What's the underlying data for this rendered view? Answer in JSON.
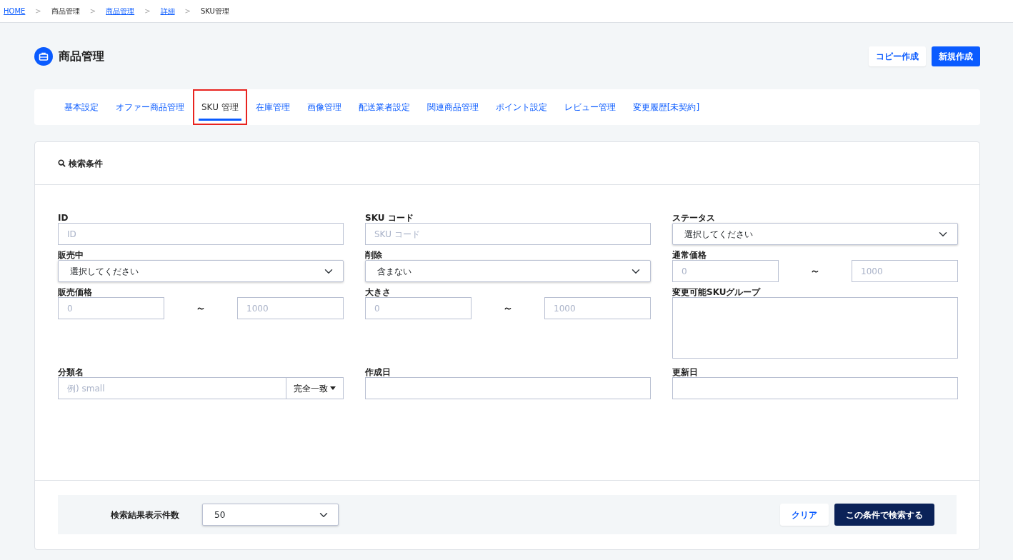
{
  "breadcrumb": [
    {
      "label": "HOME",
      "link": true
    },
    {
      "label": "商品管理",
      "link": false
    },
    {
      "label": "商品管理",
      "link": true
    },
    {
      "label": "詳細",
      "link": true
    },
    {
      "label": "SKU管理",
      "link": false
    }
  ],
  "breadcrumb_separator": ">",
  "page_title": "商品管理",
  "header_buttons": [
    {
      "label": "コピー作成",
      "kind": "secondary"
    },
    {
      "label": "新規作成",
      "kind": "primary"
    }
  ],
  "tabs": [
    {
      "label": "基本設定",
      "selected": false,
      "highlighted": false
    },
    {
      "label": "オファー商品管理",
      "selected": false,
      "highlighted": false
    },
    {
      "label": "SKU 管理",
      "selected": true,
      "highlighted": true
    },
    {
      "label": "在庫管理",
      "selected": false,
      "highlighted": false
    },
    {
      "label": "画像管理",
      "selected": false,
      "highlighted": false
    },
    {
      "label": "配送業者設定",
      "selected": false,
      "highlighted": false
    },
    {
      "label": "関連商品管理",
      "selected": false,
      "highlighted": false
    },
    {
      "label": "ポイント設定",
      "selected": false,
      "highlighted": false
    },
    {
      "label": "レビュー管理",
      "selected": false,
      "highlighted": false
    },
    {
      "label": "変更履歴[未契約]",
      "selected": false,
      "highlighted": false
    }
  ],
  "search_panel": {
    "title": "検索条件",
    "fields": [
      {
        "label": "ID",
        "kind": "text",
        "placeholder": "ID"
      },
      {
        "label": "SKU コード",
        "kind": "text",
        "placeholder": "SKU コード"
      },
      {
        "label": "ステータス",
        "kind": "select",
        "value": "選択してください"
      },
      {
        "label": "販売中",
        "kind": "select",
        "value": "選択してください"
      },
      {
        "label": "削除",
        "kind": "select",
        "value": "含まない"
      },
      {
        "label": "通常価格",
        "kind": "range",
        "from_placeholder": "0",
        "separator": "～",
        "to_placeholder": "1000"
      },
      {
        "label": "販売価格",
        "kind": "range",
        "from_placeholder": "0",
        "separator": "～",
        "to_placeholder": "1000"
      },
      {
        "label": "大きさ",
        "kind": "range",
        "from_placeholder": "0",
        "separator": "～",
        "to_placeholder": "1000"
      },
      {
        "label": "変更可能SKUグループ",
        "kind": "textarea"
      },
      {
        "label": "分類名",
        "kind": "combo",
        "placeholder": "例) small",
        "button": "完全一致"
      },
      {
        "label": "作成日",
        "kind": "date"
      },
      {
        "label": "更新日",
        "kind": "date"
      }
    ],
    "page_size_label": "検索結果表示件数",
    "page_size": "50",
    "buttons": [
      {
        "label": "クリア",
        "kind": "secondary"
      },
      {
        "label": "この条件で検索する",
        "kind": "dark"
      }
    ]
  }
}
